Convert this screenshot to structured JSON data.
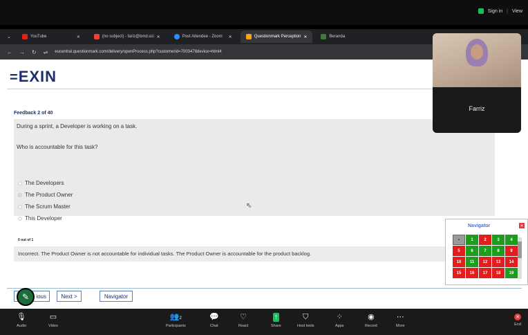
{
  "topbar": {
    "sign_in": "Sign in",
    "view": "View"
  },
  "tabs": [
    {
      "title": "YouTube",
      "color": "#e62117"
    },
    {
      "title": "(no subject) - fariz@bmd.sci",
      "color": "#ea4335"
    },
    {
      "title": "Post Attendee - Zoom",
      "color": "#2d8cff"
    },
    {
      "title": "Questionmark Perception",
      "color": "#f7a21b"
    },
    {
      "title": "Beranda",
      "color": "#3a7d3a"
    }
  ],
  "url": "eucentral.questionmark.com/delivery/openProcess.php?customerid=7003478device=html4",
  "brand": {
    "logo_text": "EXIN"
  },
  "feedback": {
    "title": "Feedback 2 of  40",
    "intro": "During a sprint, a Developer is working on a task.",
    "question": "Who is accountable for this task?",
    "options": [
      "The Developers",
      "The Product Owner",
      "The Scrum Master",
      "This Developer"
    ],
    "score": "0 out of 1",
    "result": "Incorrect. The Product Owner is not accountable for individual tasks. The Product Owner is accountable for the product backlog."
  },
  "buttons": {
    "previous": "ious",
    "next": "Next >",
    "navigator": "Navigator"
  },
  "participant": {
    "name": "Farriz"
  },
  "navigator": {
    "title": "Navigator",
    "cells": [
      {
        "n": "•",
        "c": "#999999"
      },
      {
        "n": "1",
        "c": "#1d9d1d"
      },
      {
        "n": "2",
        "c": "#e21d1d"
      },
      {
        "n": "3",
        "c": "#1d9d1d"
      },
      {
        "n": "4",
        "c": "#1d9d1d"
      },
      {
        "n": "5",
        "c": "#e21d1d"
      },
      {
        "n": "6",
        "c": "#1d9d1d"
      },
      {
        "n": "7",
        "c": "#1d9d1d"
      },
      {
        "n": "8",
        "c": "#1d9d1d"
      },
      {
        "n": "9",
        "c": "#e21d1d"
      },
      {
        "n": "10",
        "c": "#e21d1d"
      },
      {
        "n": "11",
        "c": "#1d9d1d"
      },
      {
        "n": "12",
        "c": "#e21d1d"
      },
      {
        "n": "13",
        "c": "#e21d1d"
      },
      {
        "n": "14",
        "c": "#e21d1d"
      },
      {
        "n": "15",
        "c": "#e21d1d"
      },
      {
        "n": "16",
        "c": "#e21d1d"
      },
      {
        "n": "17",
        "c": "#e21d1d"
      },
      {
        "n": "18",
        "c": "#e21d1d"
      },
      {
        "n": "19",
        "c": "#1d9d1d"
      }
    ]
  },
  "zoom_toolbar": {
    "audio": "Audio",
    "video": "Video",
    "participants": "Participants",
    "participants_count": "2",
    "chat": "Chat",
    "react": "React",
    "share": "Share",
    "host_tools": "Host tools",
    "apps": "Apps",
    "record": "Record",
    "more": "More",
    "end": "End"
  }
}
